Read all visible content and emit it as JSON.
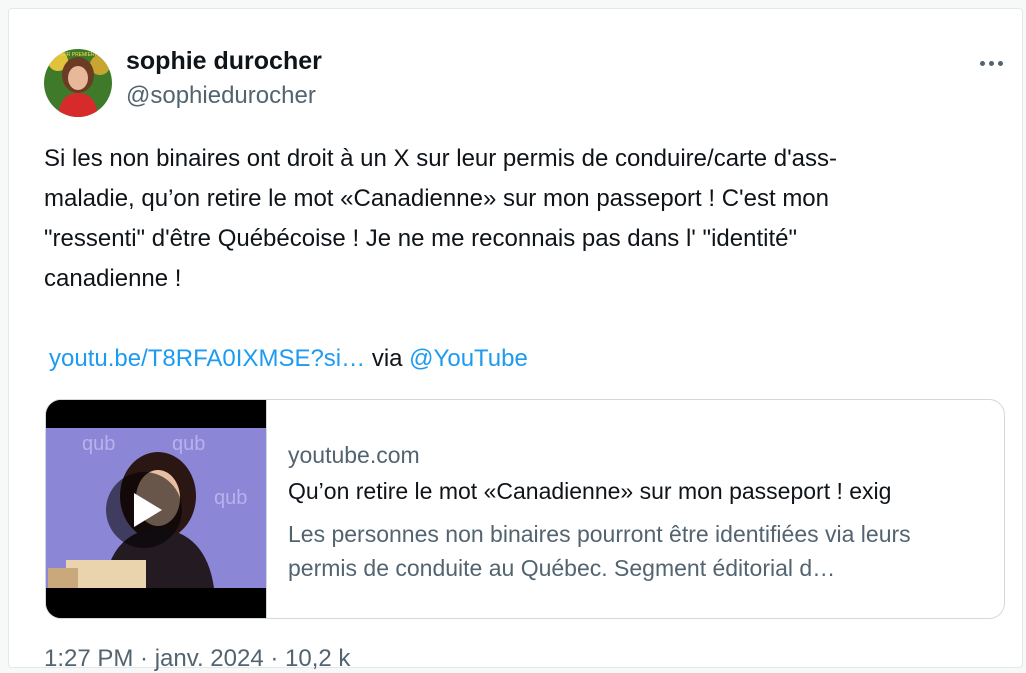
{
  "tweet": {
    "author_name": "sophie durocher",
    "author_handle": "@sophiedurocher",
    "avatar_badge_text": "VOIR PREMIERE",
    "text": "Si les non binaires ont droit à un X sur leur permis de conduire/carte d'ass-\nmaladie, qu’on retire le mot «Canadienne» sur mon passeport ! C'est mon\n\"ressenti\" d'être Québécoise ! Je ne me reconnais pas dans l' \"identité\"\ncanadienne !",
    "link_text": "youtu.be/T8RFA0IXMSE?si…",
    "via_text": "via",
    "via_mention": "@YouTube",
    "meta_text": "1:27 PM · janv. 2024 · 10,2 k"
  },
  "preview": {
    "domain": "youtube.com",
    "title": "Qu’on retire le mot «Canadienne» sur mon passeport ! exig",
    "description": "Les personnes non binaires pourront être identifiées via leurs permis de conduite au Québec. Segment éditorial d…",
    "thumb_watermark": "qub"
  },
  "icons": [
    "more-icon",
    "play-icon"
  ],
  "colors": {
    "link": "#1d9bf0",
    "secondary": "#536471"
  }
}
